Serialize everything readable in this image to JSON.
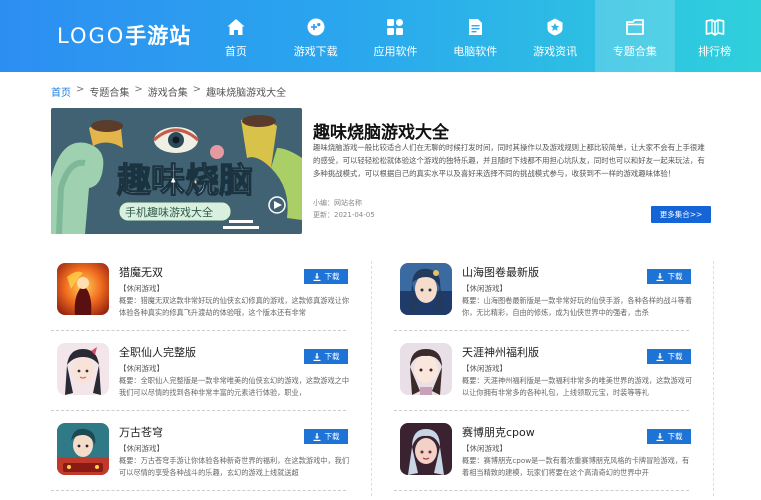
{
  "header": {
    "logo_latin": "LOGO",
    "logo_cn": "手游站",
    "nav": [
      {
        "label": "首页",
        "icon": "home-icon"
      },
      {
        "label": "游戏下载",
        "icon": "gamepad-icon"
      },
      {
        "label": "应用软件",
        "icon": "apps-icon"
      },
      {
        "label": "电脑软件",
        "icon": "document-icon"
      },
      {
        "label": "游戏资讯",
        "icon": "badge-icon"
      },
      {
        "label": "专题合集",
        "icon": "folder-icon"
      },
      {
        "label": "排行榜",
        "icon": "book-icon"
      }
    ],
    "active_nav": "专题合集",
    "colors": {
      "gradient_start": "#2d8ef2",
      "gradient_end": "#2fd0dc"
    }
  },
  "breadcrumb": {
    "items": [
      "首页",
      "专题合集",
      "游戏合集",
      "趣味烧脑游戏大全"
    ],
    "separator": ">"
  },
  "feature": {
    "banner_title": "趣味烧脑",
    "banner_subtitle": "手机趣味游戏大全",
    "title": "趣味烧脑游戏大全",
    "description": "趣味烧脑游戏一般比较适合人们在无聊的时候打发时间，同时其操作以及游戏规则上都比较简单，让大家不会有上手很难的感受，可以轻轻松松就体验这个游戏的独特乐趣，并且随时下线都不用担心坑队友，同时也可以和好友一起来玩法，有多种挑战模式，可以根据自己的真实水平以及喜好来选择不同的挑战模式参与，收获到不一样的游戏趣味体验！",
    "editor": "小编：网站名称",
    "updated": "更新：2021-04-05",
    "more_label": "更多集合>>"
  },
  "games": [
    {
      "name": "猎魔无双",
      "tag": "【休闲游戏】",
      "desc": "概要：猎魔无双这款非常好玩的仙侠玄幻修真的游戏，这款修真游戏让你体验各种真实的修真飞升渡劫的体验哦，这个版本还有非常",
      "download": "下载",
      "icon": "fire-warrior-icon"
    },
    {
      "name": "山海图卷最新版",
      "tag": "【休闲游戏】",
      "desc": "概要：山海图卷最新版是一款非常好玩的仙侠手游，各种各样的战斗等着你，无比精彩，自由的修炼，成为仙侠世界中的强者，击杀",
      "download": "下载",
      "icon": "fairy-girl-icon"
    },
    {
      "name": "全职仙人完整版",
      "tag": "【休闲游戏】",
      "desc": "概要：全职仙人完整版是一款非常唯美的仙侠玄幻的游戏，这款游戏之中我们可以尽情的找到各种非常丰富的元素进行体验，职业，",
      "download": "下载",
      "icon": "immortal-girl-icon"
    },
    {
      "name": "天涯神州福利版",
      "tag": "【休闲游戏】",
      "desc": "概要：天涯神州福利版是一款福利非常多的唯美世界的游戏，这款游戏可以让你拥有非常多的各种礼包，上线领取元宝，时装等等礼",
      "download": "下载",
      "icon": "heroine-icon"
    },
    {
      "name": "万古苍穹",
      "tag": "【休闲游戏】",
      "desc": "概要：万古苍穹手游让你体验各种新奇世界的福利，在这款游戏中，我们可以尽情的享受各种战斗的乐趣，玄幻的游戏上线就送超",
      "download": "下载",
      "icon": "hero-icon"
    },
    {
      "name": "赛博朋克cpow",
      "tag": "【休闲游戏】",
      "desc": "概要：赛博朋克cpow是一款有着浓重赛博朋克风格的卡牌冒险游戏，有着相当精致的建模，玩家们将要在这个高清奇幻的世界中开",
      "download": "下载",
      "icon": "cyberpunk-girl-icon"
    }
  ],
  "colors": {
    "accent": "#1b7fe0",
    "button": "#1e74d6",
    "more_button": "#1565d8"
  }
}
